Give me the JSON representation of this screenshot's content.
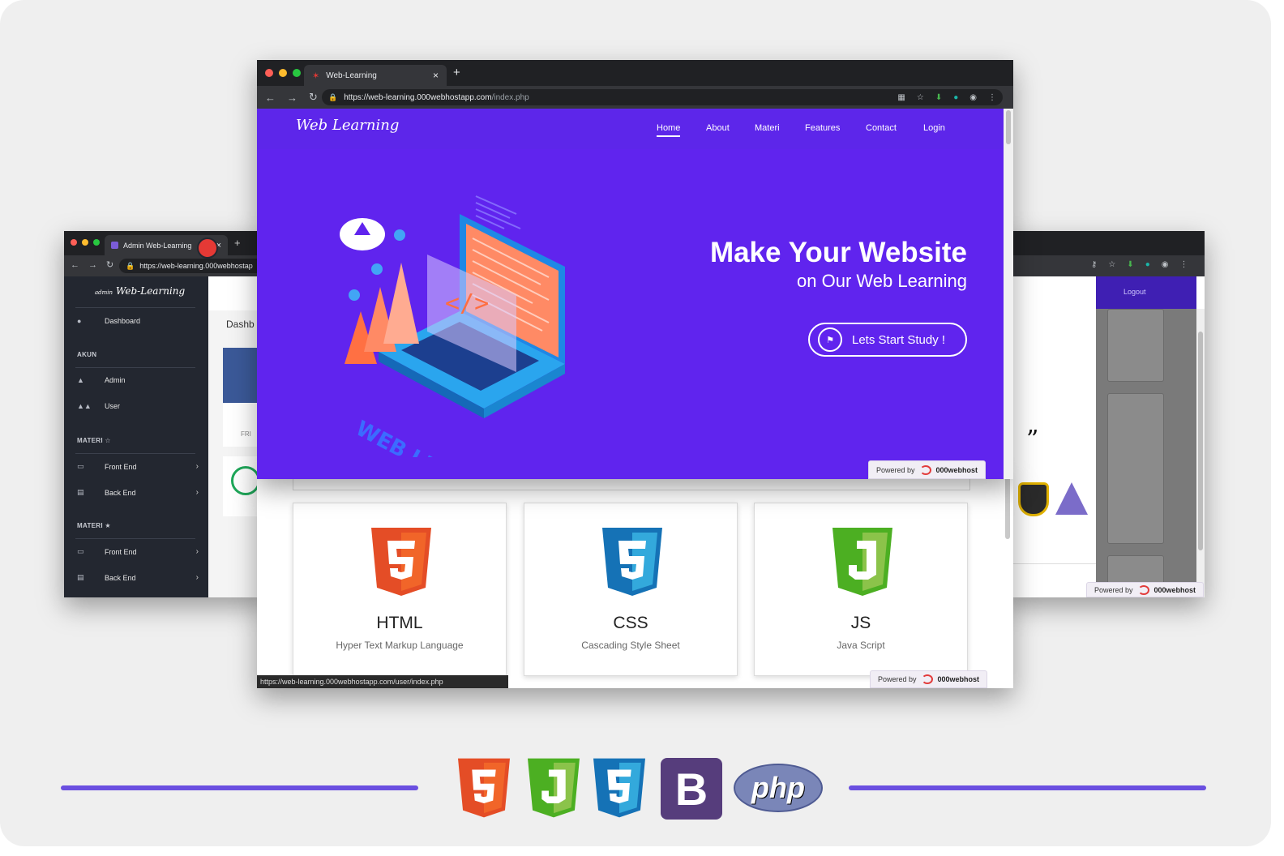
{
  "colors": {
    "hero_bg": "#6024ee",
    "accent_line": "#6a4fe0",
    "html5": "#e44d26",
    "css3": "#1572b6",
    "js": "#4caf22",
    "bootstrap": "#563d7c",
    "php": "#7a86b8"
  },
  "main_browser": {
    "tab_title": "Web-Learning",
    "tab_close": "×",
    "new_tab": "+",
    "url_host": "https://web-learning.000webhostapp.com",
    "url_path": "/index.php",
    "status_url": "https://web-learning.000webhostapp.com/user/index.php"
  },
  "site": {
    "brand": "Web Learning",
    "menu": [
      "Home",
      "About",
      "Materi",
      "Features",
      "Contact",
      "Login"
    ],
    "hero_title": "Make Your Website",
    "hero_subtitle": "on Our Web Learning",
    "cta_label": "Lets Start Study !",
    "illustration_text": "WEB LEARNING",
    "illustration_code": "</>",
    "powered_by": "Powered by",
    "powered_brand": "000webhost",
    "cards": [
      {
        "icon": "html5-icon",
        "name": "HTML",
        "desc": "Hyper Text Markup Language"
      },
      {
        "icon": "css3-icon",
        "name": "CSS",
        "desc": "Cascading Style Sheet"
      },
      {
        "icon": "js-icon",
        "name": "JS",
        "desc": "Java Script"
      }
    ]
  },
  "admin_browser": {
    "tab_title": "Admin Web-Learning",
    "tab_close": "×",
    "new_tab": "+",
    "url_text": "https://web-learning.000webhostap",
    "brand_small": "admin",
    "brand": "Web-Learning",
    "page_title": "Dashb",
    "card_label": "FRI",
    "sidebar": {
      "dashboard": "Dashboard",
      "akun_header": "AKUN",
      "admin": "Admin",
      "user": "User",
      "materi_header_1": "MATERI ☆",
      "materi_header_2": "MATERI ★",
      "front_end": "Front End",
      "back_end": "Back End"
    }
  },
  "right_browser": {
    "logout": "Logout",
    "quote": "”",
    "powered_by": "Powered by",
    "powered_brand": "000webhost"
  },
  "tech_stack": [
    "html5-icon",
    "js-icon",
    "css3-icon",
    "bootstrap-icon",
    "php-icon"
  ],
  "tech_labels": {
    "bootstrap": "B",
    "php": "php"
  }
}
